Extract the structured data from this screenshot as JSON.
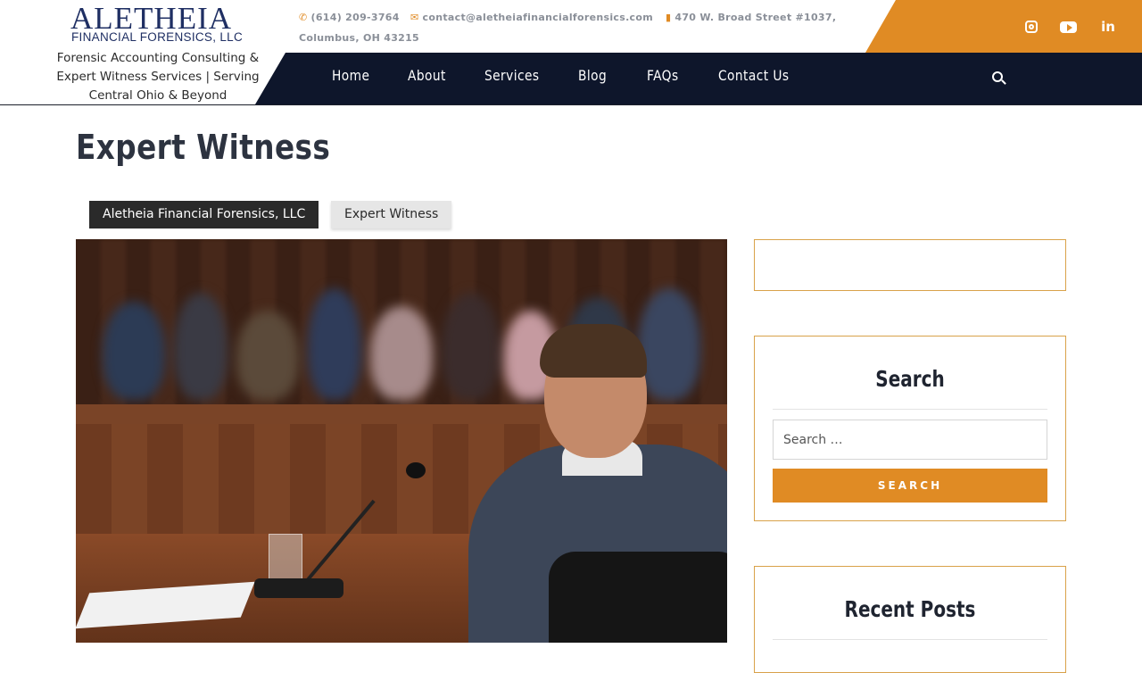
{
  "brand": {
    "name": "ALETHEIA",
    "sub": "FINANCIAL FORENSICS, LLC",
    "tagline": "Forensic Accounting Consulting & Expert Witness Services | Serving Central Ohio & Beyond"
  },
  "contact": {
    "phone": "(614) 209-3764",
    "email": "contact@aletheiafinancialforensics.com",
    "address_line1": "470 W. Broad Street #1037,",
    "address_line2": "Columbus, OH 43215"
  },
  "social": {
    "instagram": "instagram-icon",
    "youtube": "youtube-icon",
    "linkedin": "in"
  },
  "nav": {
    "items": [
      "Home",
      "About",
      "Services",
      "Blog",
      "FAQs",
      "Contact Us"
    ]
  },
  "page": {
    "title": "Expert Witness",
    "breadcrumb": [
      "Aletheia Financial Forensics, LLC",
      "Expert Witness"
    ]
  },
  "sidebar": {
    "search_title": "Search",
    "search_placeholder": "Search …",
    "search_button": "SEARCH",
    "recent_title": "Recent Posts"
  },
  "colors": {
    "accent": "#e08b24",
    "navy": "#0e162b",
    "brand_blue": "#1f2f63"
  }
}
